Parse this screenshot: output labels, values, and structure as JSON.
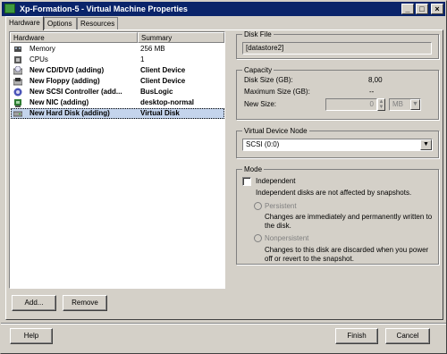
{
  "window": {
    "title": "Xp-Formation-5 - Virtual Machine Properties",
    "buttons": [
      "_",
      "□",
      "×"
    ]
  },
  "tabs": [
    {
      "label": "Hardware",
      "active": true
    },
    {
      "label": "Options",
      "active": false
    },
    {
      "label": "Resources",
      "active": false
    }
  ],
  "hardware_list": {
    "columns": [
      "Hardware",
      "Summary"
    ],
    "rows": [
      {
        "name": "Memory",
        "summary": "256 MB",
        "icon": "memory-icon",
        "bold": false,
        "selected": false
      },
      {
        "name": "CPUs",
        "summary": "1",
        "icon": "cpu-icon",
        "bold": false,
        "selected": false
      },
      {
        "name": "New CD/DVD (adding)",
        "summary": "Client Device",
        "icon": "cd-dvd-icon",
        "bold": true,
        "selected": false
      },
      {
        "name": "New Floppy (adding)",
        "summary": "Client Device",
        "icon": "floppy-icon",
        "bold": true,
        "selected": false
      },
      {
        "name": "New SCSI Controller (add...",
        "summary": "BusLogic",
        "icon": "scsi-controller-icon",
        "bold": true,
        "selected": false
      },
      {
        "name": "New NIC (adding)",
        "summary": "desktop-normal",
        "icon": "nic-icon",
        "bold": true,
        "selected": false
      },
      {
        "name": "New Hard Disk (adding)",
        "summary": "Virtual Disk",
        "icon": "hard-disk-icon",
        "bold": true,
        "selected": true
      }
    ]
  },
  "list_buttons": {
    "add": "Add...",
    "remove": "Remove"
  },
  "disk_file": {
    "label": "Disk File",
    "value": "[datastore2]"
  },
  "capacity": {
    "label": "Capacity",
    "disk_size_label": "Disk Size (GB):",
    "disk_size_value": "8,00",
    "max_size_label": "Maximum Size (GB):",
    "max_size_value": "--",
    "new_size_label": "New Size:",
    "new_size_value": "0",
    "unit": "MB"
  },
  "device_node": {
    "label": "Virtual Device Node",
    "value": "SCSI (0:0)"
  },
  "mode": {
    "label": "Mode",
    "independent_label": "Independent",
    "independent_checked": false,
    "independent_desc": "Independent disks are not affected by snapshots.",
    "persistent_label": "Persistent",
    "persistent_desc_1": "Changes are immediately and permanently written to",
    "persistent_desc_2": "the disk.",
    "nonpersistent_label": "Nonpersistent",
    "nonpersistent_desc_1": "Changes to this disk are discarded when you power",
    "nonpersistent_desc_2": "off or revert to the snapshot."
  },
  "footer": {
    "help": "Help",
    "finish": "Finish",
    "cancel": "Cancel"
  }
}
